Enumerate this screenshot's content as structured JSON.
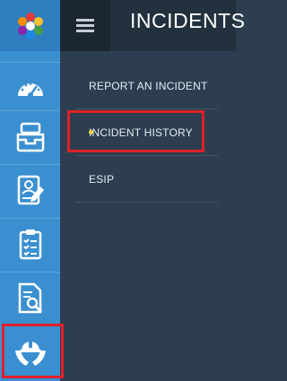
{
  "header": {
    "title": "INCIDENTS"
  },
  "sidebar": {
    "items": [
      {
        "icon": "dashboard-gauge-icon"
      },
      {
        "icon": "inbox-tray-icon"
      },
      {
        "icon": "user-profile-document-icon"
      },
      {
        "icon": "checklist-clipboard-icon"
      },
      {
        "icon": "document-search-icon"
      },
      {
        "icon": "hard-hat-hands-icon",
        "active": true
      }
    ]
  },
  "submenu": {
    "items": [
      {
        "label": "REPORT AN INCIDENT"
      },
      {
        "label": "INCIDENT HISTORY",
        "active": true
      },
      {
        "label": "ESIP"
      }
    ]
  },
  "colors": {
    "rail": "#3a8fd0",
    "panel": "#2c3e50",
    "highlight": "#e0202a",
    "active_dot": "#f5d842"
  }
}
